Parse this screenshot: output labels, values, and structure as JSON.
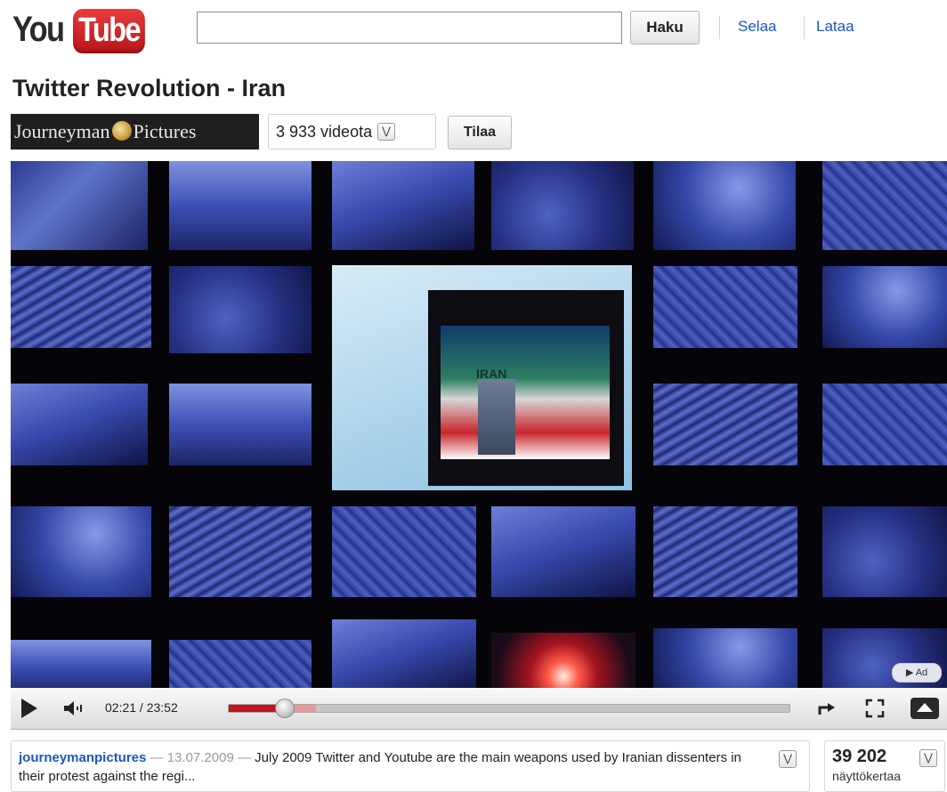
{
  "header": {
    "logo_left": "You",
    "logo_right": "Tube",
    "search": {
      "value": "",
      "placeholder": ""
    },
    "search_button_label": "Haku",
    "nav_links": [
      "Selaa",
      "Lataa"
    ]
  },
  "video": {
    "title": "Twitter Revolution - Iran",
    "channel_logo_left": "Journeyman",
    "channel_logo_right": "Pictures",
    "video_count_label": "3 933 videota",
    "subscribe_label": "Tilaa",
    "ad_badge": "▶ Ad",
    "screen_text": "IRAN"
  },
  "player": {
    "time_display": "02:21 / 23:52",
    "progress_played_fraction": 0.0985,
    "progress_buffered_fraction": 0.155
  },
  "info": {
    "uploader": "journeymanpictures",
    "sep1": " — ",
    "date": "13.07.2009",
    "sep2": " — ",
    "description": "July 2009 Twitter and Youtube are the main weapons used by Iranian dissenters in their protest against the regi..."
  },
  "views": {
    "count": "39 202",
    "label": "näyttökertaa"
  },
  "colors": {
    "link_blue": "#1a56c4",
    "brand_red": "#c4141c"
  },
  "icons": [
    "play-icon",
    "volume-icon",
    "popout-icon",
    "fullscreen-icon",
    "eject-icon",
    "chevron-down-icon"
  ]
}
